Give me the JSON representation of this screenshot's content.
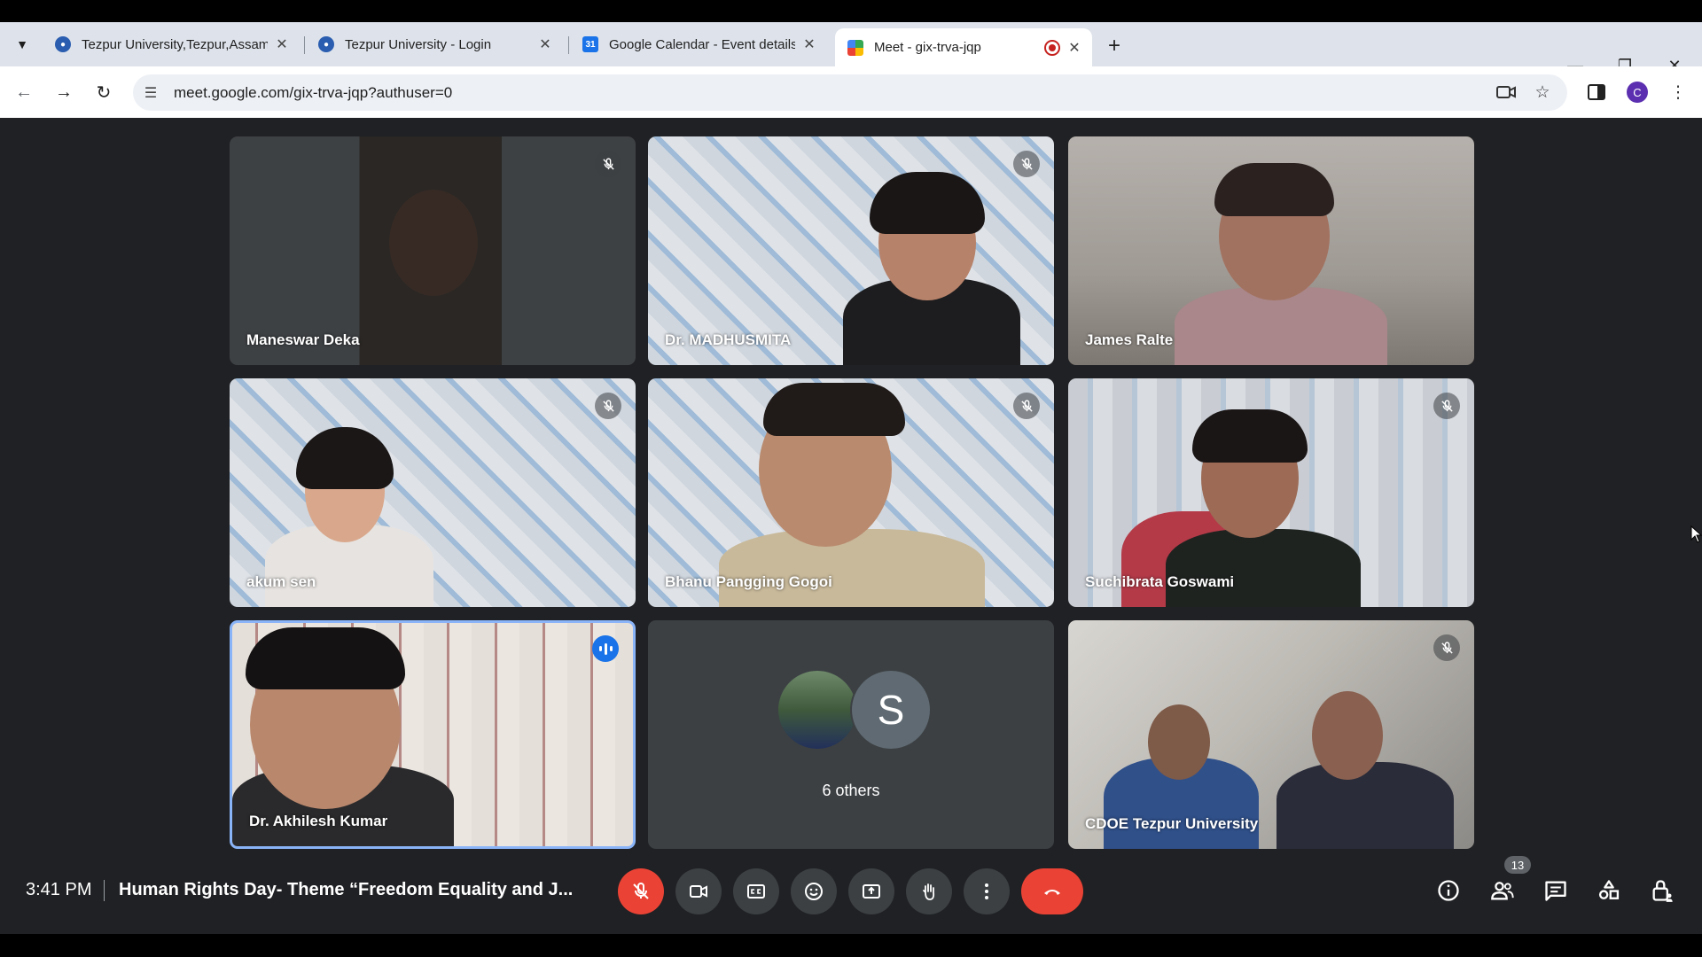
{
  "browser": {
    "tabs": [
      {
        "title": "Tezpur University,Tezpur,Assam",
        "favicon": "tezpur-university-icon"
      },
      {
        "title": "Tezpur University - Login",
        "favicon": "tezpur-login-icon"
      },
      {
        "title": "Google Calendar - Event details",
        "favicon": "google-calendar-icon",
        "favicon_text": "31"
      },
      {
        "title": "Meet - gix-trva-jqp",
        "favicon": "google-meet-icon",
        "active": true
      }
    ],
    "url": "meet.google.com/gix-trva-jqp?authuser=0",
    "profile_initial": "C"
  },
  "meet": {
    "participants": [
      {
        "name": "Maneswar Deka",
        "muted": true
      },
      {
        "name": "Dr. MADHUSMITA",
        "muted": true
      },
      {
        "name": "James Ralte",
        "muted": false
      },
      {
        "name": "akum sen",
        "muted": true
      },
      {
        "name": "Bhanu Pangging Gogoi",
        "muted": true
      },
      {
        "name": "Suchibrata Goswami",
        "muted": true
      },
      {
        "name": "Dr. Akhilesh Kumar",
        "speaking": true
      },
      {
        "name": "6 others",
        "avatar_initial": "S"
      },
      {
        "name": "CDOE Tezpur University",
        "muted": true
      }
    ],
    "time": "3:41 PM",
    "title": "Human Rights Day- Theme “Freedom Equality and J...",
    "participant_count": "13"
  },
  "colors": {
    "meet_bg": "#202124",
    "tile_bg": "#3c4043",
    "danger": "#ea4335",
    "speaking": "#8ab4f8"
  }
}
